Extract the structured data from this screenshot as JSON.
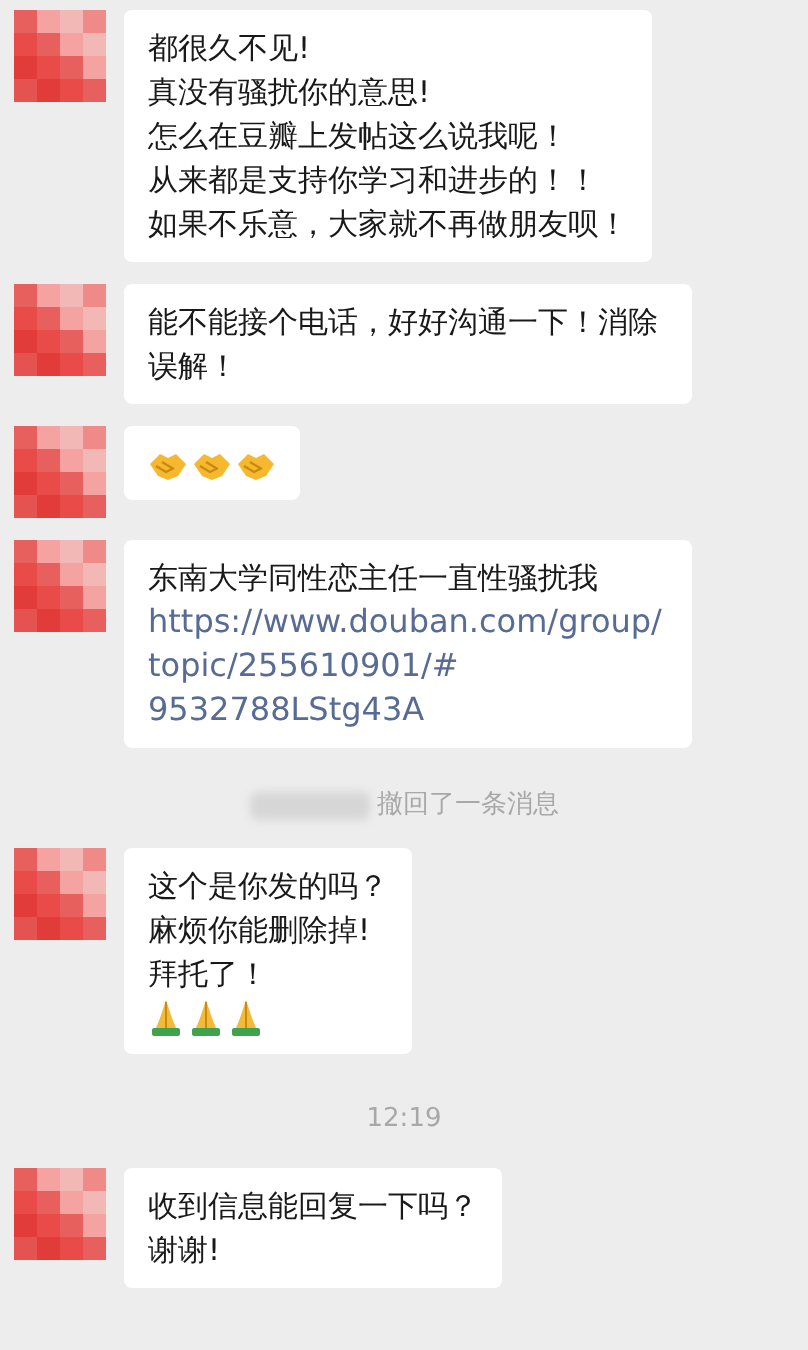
{
  "messages": [
    {
      "kind": "text",
      "lines": [
        "都很久不见!",
        "真没有骚扰你的意思!",
        "怎么在豆瓣上发帖这么说我呢！",
        "从来都是支持你学习和进步的！！",
        "如果不乐意，大家就不再做朋友呗！"
      ]
    },
    {
      "kind": "text",
      "lines": [
        "能不能接个电话，好好沟通一下！消除误解！"
      ]
    },
    {
      "kind": "handshake_emoji"
    },
    {
      "kind": "link",
      "lines": [
        "东南大学同性恋主任一直性骚扰我"
      ],
      "link": "https://www.douban.com/group/topic/255610901/#9532788LStg43A"
    },
    {
      "kind": "recall",
      "text": "撤回了一条消息"
    },
    {
      "kind": "text_pray",
      "lines": [
        "这个是你发的吗？",
        "麻烦你能删除掉!",
        "拜托了！"
      ]
    },
    {
      "kind": "time",
      "text": "12:19"
    },
    {
      "kind": "text",
      "lines": [
        "收到信息能回复一下吗？",
        "谢谢!"
      ]
    }
  ]
}
